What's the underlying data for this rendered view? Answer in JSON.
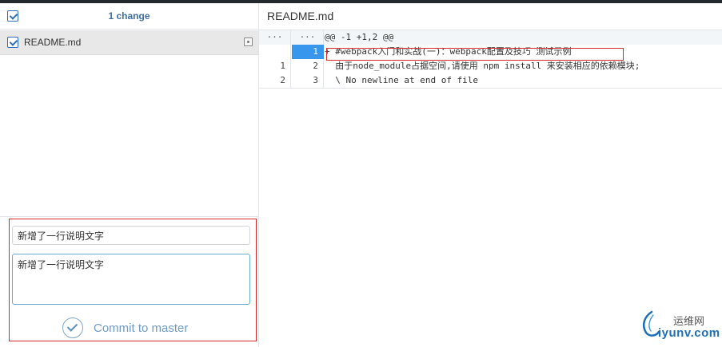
{
  "changes": {
    "count_label": "1 change",
    "select_all_checked": true,
    "files": [
      {
        "name": "README.md",
        "checked": true,
        "status": "modified"
      }
    ]
  },
  "commit": {
    "summary_value": "新增了一行说明文字",
    "description_value": "新增了一行说明文字",
    "button_label": "Commit to master"
  },
  "diff": {
    "file_title": "README.md",
    "rows": [
      {
        "type": "hunk",
        "old": "···",
        "new": "···",
        "text": "@@ -1 +1,2 @@"
      },
      {
        "type": "added",
        "old": "",
        "new": "1",
        "text": "+ #webpack入门和实战(一)：webpack配置及技巧 测试示例"
      },
      {
        "type": "context",
        "old": "1",
        "new": "2",
        "text": "  由于node_module占据空间,请使用 npm install 来安装相应的依赖模块;"
      },
      {
        "type": "context",
        "old": "2",
        "new": "3",
        "text": "  \\ No newline at end of file"
      }
    ]
  },
  "watermark": {
    "cn": "运维网",
    "en": "iyunv.com"
  },
  "colors": {
    "accent": "#3897ec",
    "highlight_border": "#d22a2a",
    "commit_text": "#6f9cc7"
  }
}
